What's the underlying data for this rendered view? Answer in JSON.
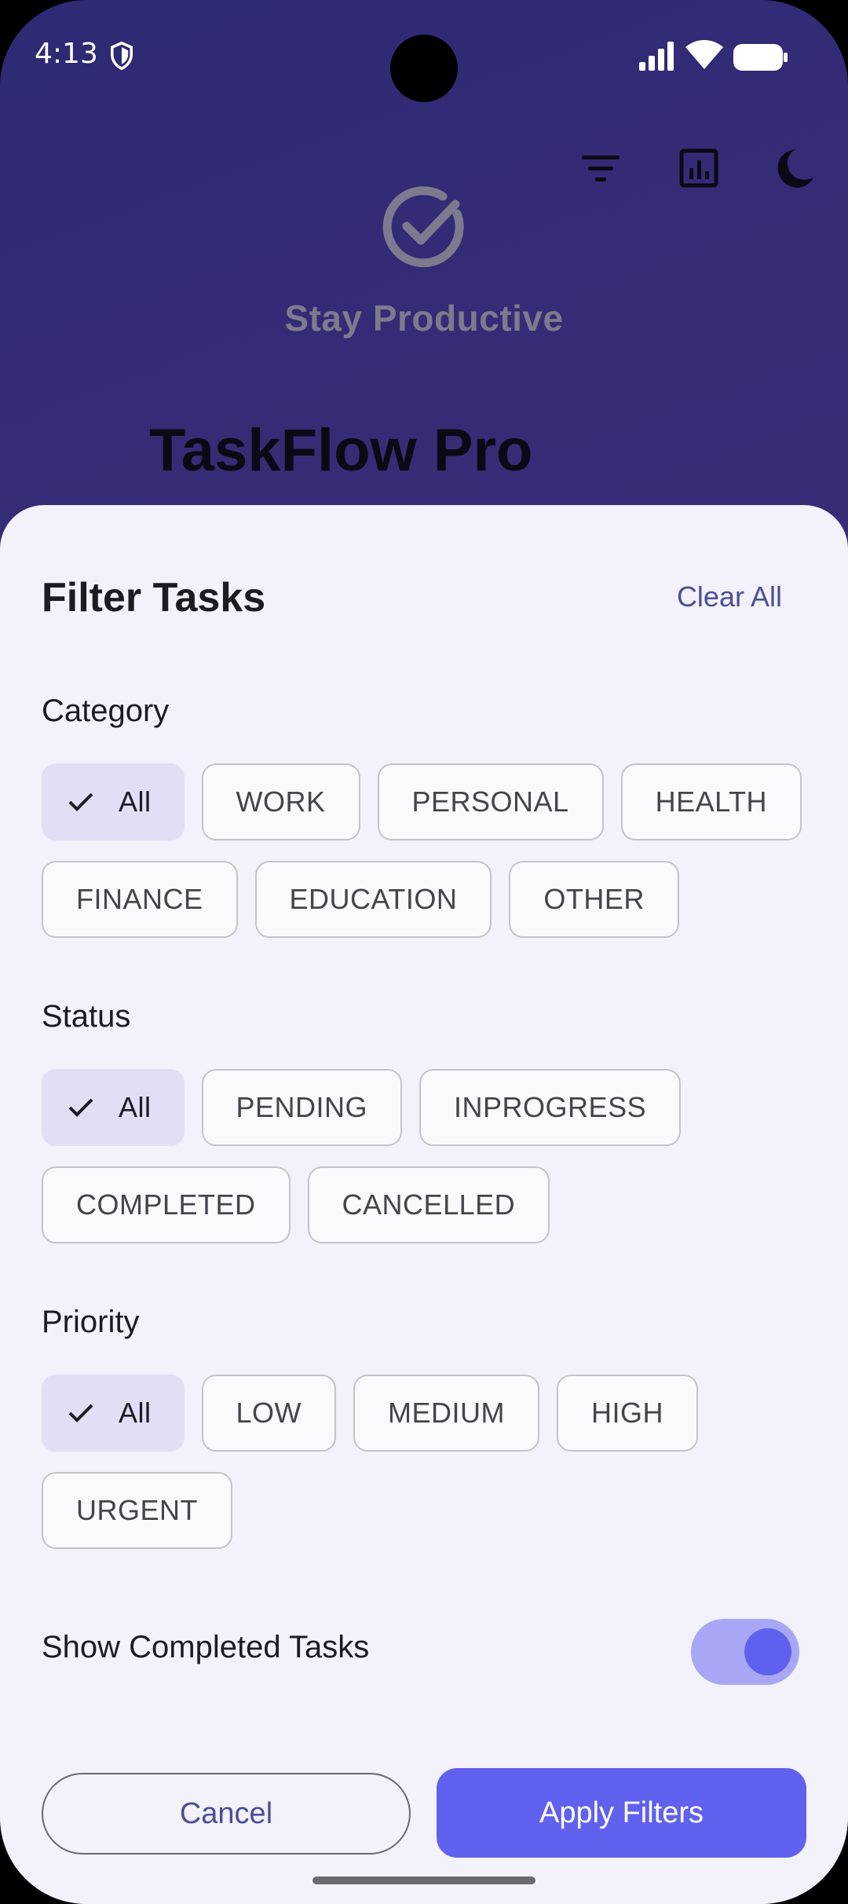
{
  "status_bar": {
    "time": "4:13"
  },
  "hero": {
    "tagline": "Stay Productive",
    "app_title": "TaskFlow Pro"
  },
  "sheet": {
    "title": "Filter Tasks",
    "clear_all": "Clear All",
    "category": {
      "label": "Category",
      "options": [
        "All",
        "WORK",
        "PERSONAL",
        "HEALTH",
        "FINANCE",
        "EDUCATION",
        "OTHER"
      ],
      "selected": "All"
    },
    "status": {
      "label": "Status",
      "options": [
        "All",
        "PENDING",
        "INPROGRESS",
        "COMPLETED",
        "CANCELLED"
      ],
      "selected": "All"
    },
    "priority": {
      "label": "Priority",
      "options": [
        "All",
        "LOW",
        "MEDIUM",
        "HIGH",
        "URGENT"
      ],
      "selected": "All"
    },
    "show_completed": {
      "label": "Show Completed Tasks",
      "on": true
    },
    "cancel_label": "Cancel",
    "apply_label": "Apply Filters"
  },
  "colors": {
    "accent": "#6061ee",
    "selected_chip": "#e1def6",
    "sheet_bg": "#f3f1f9",
    "header_bg": "#2e2a74"
  }
}
